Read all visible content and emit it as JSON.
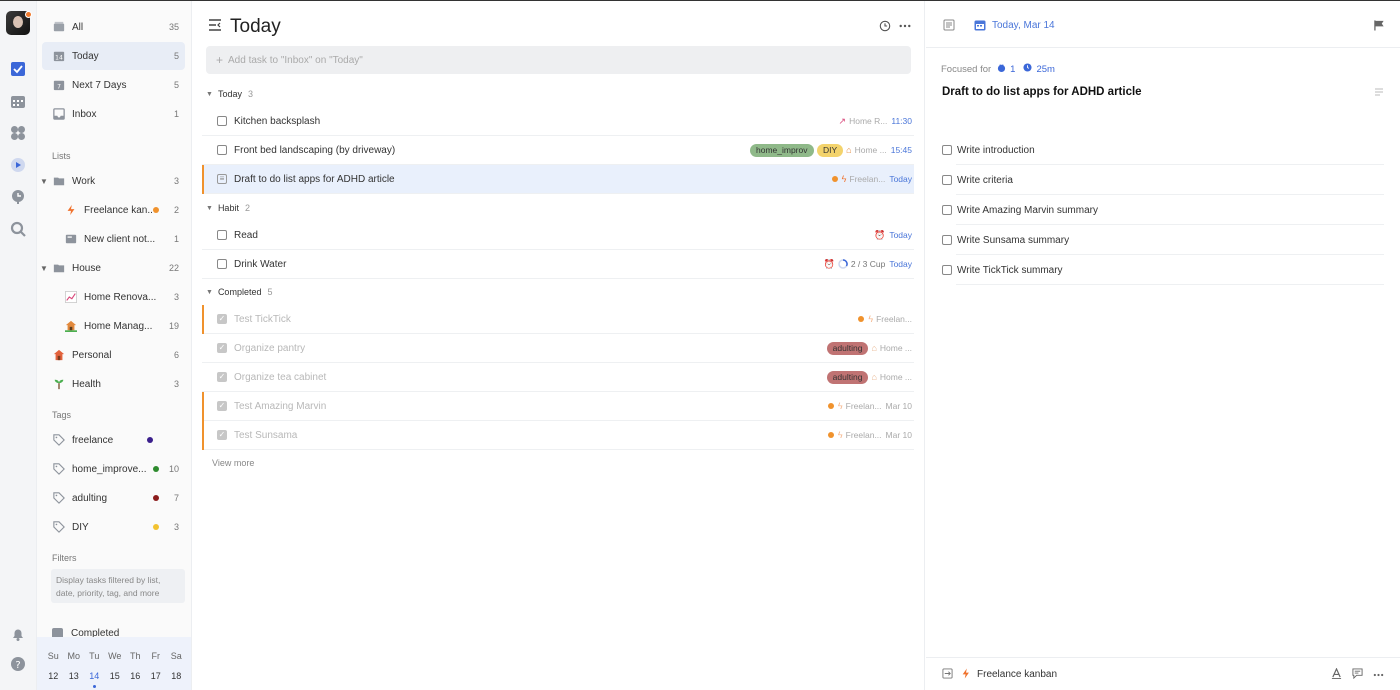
{
  "sidebar": {
    "smart": [
      {
        "label": "All",
        "count": "35"
      },
      {
        "label": "Today",
        "count": "5"
      },
      {
        "label": "Next 7 Days",
        "count": "5"
      },
      {
        "label": "Inbox",
        "count": "1"
      }
    ],
    "lists_heading": "Lists",
    "lists": [
      {
        "label": "Work",
        "count": "3"
      },
      {
        "label": "Freelance kan...",
        "count": "2"
      },
      {
        "label": "New client not...",
        "count": "1"
      },
      {
        "label": "House",
        "count": "22"
      },
      {
        "label": "Home Renova...",
        "count": "3"
      },
      {
        "label": "Home Manag...",
        "count": "19"
      },
      {
        "label": "Personal",
        "count": "6"
      },
      {
        "label": "Health",
        "count": "3"
      }
    ],
    "tags_heading": "Tags",
    "tags": [
      {
        "label": "freelance",
        "count": "",
        "color": "#3b1f8c"
      },
      {
        "label": "home_improve...",
        "count": "10",
        "color": "#2e8b2e"
      },
      {
        "label": "adulting",
        "count": "7",
        "color": "#8b1c1c"
      },
      {
        "label": "DIY",
        "count": "3",
        "color": "#f2c230"
      }
    ],
    "filters_heading": "Filters",
    "filters_hint": "Display tasks filtered by list, date, priority, tag, and more",
    "completed_label": "Completed",
    "calendar": {
      "days": [
        "Su",
        "Mo",
        "Tu",
        "We",
        "Th",
        "Fr",
        "Sa"
      ],
      "dates": [
        "12",
        "13",
        "14",
        "15",
        "16",
        "17",
        "18"
      ]
    }
  },
  "main": {
    "title": "Today",
    "add_placeholder": "Add task to \"Inbox\" on \"Today\"",
    "sections": {
      "today": {
        "label": "Today",
        "count": "3"
      },
      "habit": {
        "label": "Habit",
        "count": "2"
      },
      "completed": {
        "label": "Completed",
        "count": "5"
      }
    },
    "today_tasks": [
      {
        "title": "Kitchen backsplash",
        "project": "Home R...",
        "time": "11:30"
      },
      {
        "title": "Front bed landscaping (by driveway)",
        "tag1": "home_improv",
        "tag2": "DIY",
        "project": "Home ...",
        "time": "15:45"
      },
      {
        "title": "Draft to do list apps for ADHD article",
        "project": "Freelan...",
        "time": "Today"
      }
    ],
    "habit_tasks": [
      {
        "title": "Read",
        "time": "Today"
      },
      {
        "title": "Drink Water",
        "progress": "2 / 3 Cup",
        "time": "Today"
      }
    ],
    "completed_tasks": [
      {
        "title": "Test TickTick",
        "project": "Freelan...",
        "time": ""
      },
      {
        "title": "Organize pantry",
        "tag": "adulting",
        "project": "Home ...",
        "time": ""
      },
      {
        "title": "Organize tea cabinet",
        "tag": "adulting",
        "project": "Home ...",
        "time": ""
      },
      {
        "title": "Test Amazing Marvin",
        "project": "Freelan...",
        "time": "Mar 10"
      },
      {
        "title": "Test Sunsama",
        "project": "Freelan...",
        "time": "Mar 10"
      }
    ],
    "view_more": "View more"
  },
  "detail": {
    "date": "Today, Mar 14",
    "focused_label": "Focused for",
    "pomos": "1",
    "duration": "25m",
    "title": "Draft to do list apps for ADHD article",
    "subtasks": [
      "Write introduction",
      "Write criteria",
      "Write Amazing Marvin summary",
      "Write Sunsama summary",
      "Write TickTick summary"
    ],
    "list_name": "Freelance kanban"
  },
  "colors": {
    "accent": "#4a76d9",
    "orange": "#f0922d"
  }
}
